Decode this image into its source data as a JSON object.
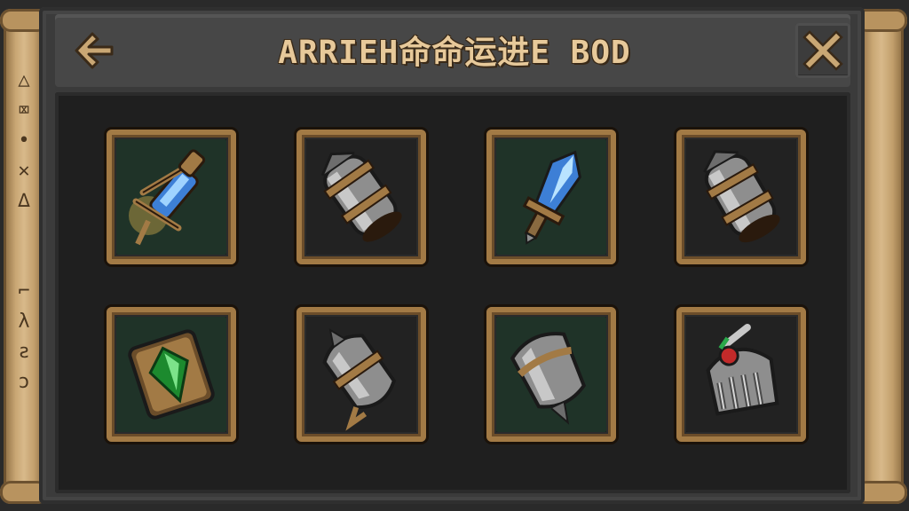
{
  "header": {
    "title": "ARRIEH命命运进E BOD",
    "back_icon": "arrow-left-icon",
    "close_icon": "close-x-icon"
  },
  "scroll_left": {
    "runes": [
      "△",
      "⌧",
      "•",
      "✕",
      "∆",
      "",
      "",
      "⌐",
      "λ",
      "ƨ",
      "ɔ"
    ]
  },
  "inventory": {
    "slots": [
      {
        "item": "crystal-crossbow-icon",
        "highlight": "green"
      },
      {
        "item": "iron-gauntlet-icon",
        "highlight": "none"
      },
      {
        "item": "blue-crystal-dagger-icon",
        "highlight": "green"
      },
      {
        "item": "iron-gauntlet-icon",
        "highlight": "none"
      },
      {
        "item": "emerald-amulet-icon",
        "highlight": "green"
      },
      {
        "item": "iron-spiked-bracer-icon",
        "highlight": "none"
      },
      {
        "item": "iron-spiked-pauldron-icon",
        "highlight": "green"
      },
      {
        "item": "steel-helmet-icon",
        "highlight": "none"
      }
    ]
  },
  "colors": {
    "title": "#e7c99a",
    "frame_gold": "#a27a45",
    "slot_green": "#1f3328",
    "slot_dark": "#222222"
  }
}
